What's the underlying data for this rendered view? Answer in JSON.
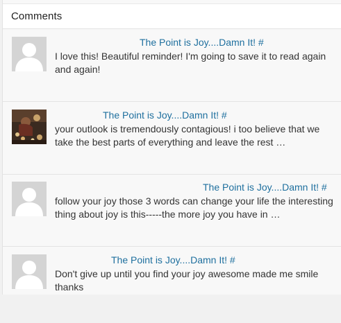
{
  "header": {
    "title": "Comments"
  },
  "comments": [
    {
      "avatar": "default-avatar",
      "post_title": "The Point is Joy....Damn It!",
      "hash": "#",
      "text": "I love this! Beautiful reminder! I'm going to save it to read again and again!"
    },
    {
      "avatar": "photo-avatar",
      "post_title": "The Point is Joy....Damn It!",
      "hash": "#",
      "text": "your outlook is tremendously contagious! i too believe that we take the best parts of everything and leave the rest …"
    },
    {
      "avatar": "default-avatar",
      "post_title": "The Point is Joy....Damn It!",
      "hash": "#",
      "text": "follow your joy those 3 words can change your life the interesting thing about joy is this-----the more joy you have in …"
    },
    {
      "avatar": "default-avatar",
      "post_title": "The Point is Joy....Damn It!",
      "hash": "#",
      "text": "Don't give up until you find your joy awesome made me smile thanks"
    }
  ],
  "colors": {
    "link": "#1e6f9e",
    "text": "#333333",
    "avatar_bg": "#d4d4d4"
  }
}
